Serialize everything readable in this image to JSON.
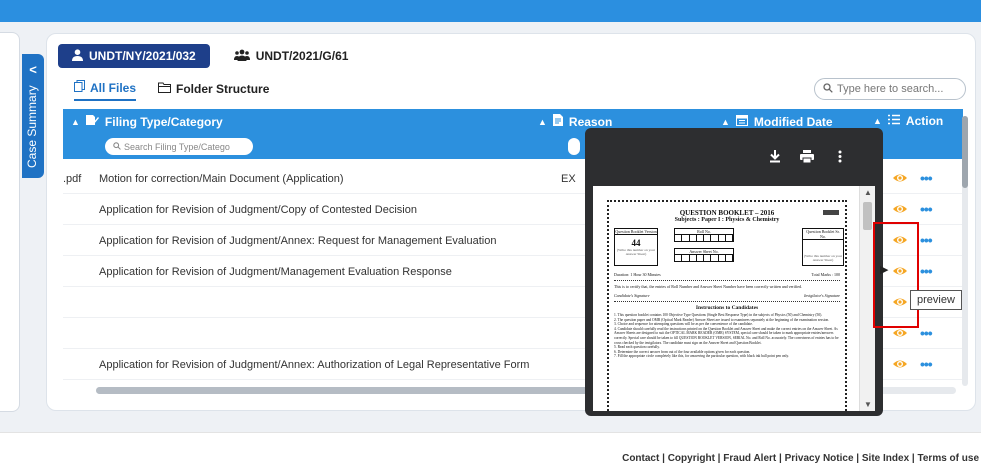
{
  "sidebar": {
    "collapse_glyph": "<",
    "label": "Case Summary"
  },
  "case_tabs": [
    {
      "label": "UNDT/NY/2021/032",
      "icon": "user-icon",
      "active": true
    },
    {
      "label": "UNDT/2021/G/61",
      "icon": "users-icon",
      "active": false
    }
  ],
  "view_tabs": [
    {
      "label": "All Files",
      "icon": "files-icon",
      "active": true
    },
    {
      "label": "Folder Structure",
      "icon": "folder-icon",
      "active": false
    }
  ],
  "search": {
    "placeholder": "Type here to search..."
  },
  "table": {
    "columns": {
      "filing": "Filing Type/Category",
      "reason": "Reason",
      "modified": "Modified Date",
      "action": "Action"
    },
    "filing_filter_placeholder": "Search Filing Type/Catego",
    "rows": [
      {
        "ext": ".pdf",
        "name": "Motion for correction/Main Document (Application)",
        "reason": "EX"
      },
      {
        "ext": "",
        "name": "Application for Revision of Judgment/Copy of Contested Decision",
        "reason": ""
      },
      {
        "ext": "",
        "name": "Application for Revision of Judgment/Annex: Request for Management Evaluation",
        "reason": ""
      },
      {
        "ext": "",
        "name": "Application for Revision of Judgment/Management Evaluation Response",
        "reason": ""
      },
      {
        "ext": "",
        "name": "",
        "reason": ""
      },
      {
        "ext": "",
        "name": "",
        "reason": ""
      },
      {
        "ext": "",
        "name": "Application for Revision of Judgment/Annex: Authorization of Legal Representative Form",
        "reason": ""
      }
    ]
  },
  "tooltip": "preview",
  "preview": {
    "document": {
      "title": "QUESTION BOOKLET – 2016",
      "subject": "Subjects : Paper I : Physics & Chemistry",
      "version_label": "Question Booklet Version",
      "version_value": "44",
      "version_note": "(Write this number on your Answer Sheet)",
      "roll_label": "Roll No.",
      "answer_sheet_label": "Answer Sheet No.",
      "serial_label": "Question Booklet Sr. No.",
      "serial_note": "(Write this number on your Answer Sheet)",
      "duration": "Duration: 1 Hour 30 Minutes",
      "total_marks": "Total Marks : 100",
      "certify": "This is to certify that, the entries of Roll Number and Answer Sheet Number have been correctly written and verified.",
      "candidate_sig": "Candidate's Signature",
      "invigilator_sig": "Invigilator's Signature",
      "instructions_title": "Instructions to Candidates",
      "instructions": [
        "1. This question booklet contains 100 Objective Type Questions (Single Best Response Type) in the subjects of Physics (50) and Chemistry (50).",
        "2. The question paper and OMR (Optical Mark Reader) Answer Sheet are issued to examinees separately at the beginning of the examination session.",
        "3. Choice and sequence for attempting questions will be as per the convenience of the candidate.",
        "4. Candidate should carefully read the instructions printed on the Question Booklet and Answer Sheet and make the correct entries on the Answer Sheet. As Answer Sheets are designed to suit the OPTICAL MARK READER (OMR) SYSTEM, special care should be taken to mark appropriate entries/answers correctly. Special care should be taken to fill QUESTION BOOKLET VERSION, SERIAL No. and Roll No. accurately. The correctness of entries has to be cross checked by the invigilators. The candidate must sign on the Answer Sheet and Question Booklet.",
        "5. Read each question carefully.",
        "6. Determine the correct answer from out of the four available options given for each question.",
        "7. Fill the appropriate circle completely like this, for answering the particular question, with black ink ball point pen only."
      ]
    }
  },
  "footer": {
    "links": [
      "Contact",
      "Copyright",
      "Fraud Alert",
      "Privacy Notice",
      "Site Index",
      "Terms of use"
    ]
  },
  "colors": {
    "primary": "#2c90de",
    "tab_active": "#1e3f8a",
    "action_eye": "#f5a623",
    "highlight": "#e00000"
  }
}
